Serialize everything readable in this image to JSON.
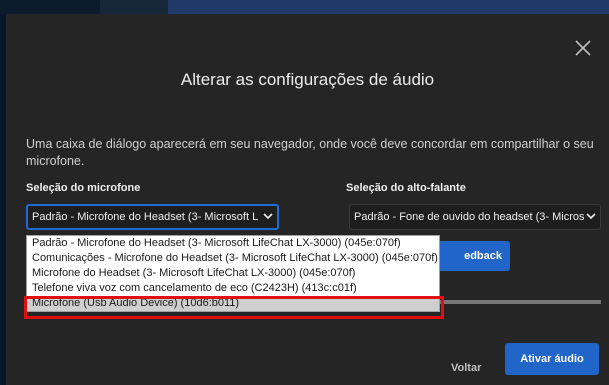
{
  "dialog": {
    "title": "Alterar as configurações de áudio",
    "description": "Uma caixa de diálogo aparecerá em seu navegador, onde você deve concordar em compartilhar o seu microfone.",
    "close_icon": "close-icon"
  },
  "microphone": {
    "label": "Seleção do microfone",
    "selected": "Padrão - Microfone do Headset (3- Microsoft L",
    "options": [
      "Padrão - Microfone do Headset (3- Microsoft LifeChat LX-3000) (045e:070f)",
      "Comunicações - Microfone do Headset (3- Microsoft LifeChat LX-3000) (045e:070f)",
      "Microfone do Headset (3- Microsoft LifeChat LX-3000) (045e:070f)",
      "Telefone viva voz com cancelamento de eco (C2423H) (413c:c01f)",
      "Microfone (Usb Audio Device) (10d6:b011)"
    ],
    "highlighted_index": 4
  },
  "speaker": {
    "label": "Seleção do alto-falante",
    "selected": "Padrão - Fone de ouvido do headset (3- Micros"
  },
  "feedback_button": "edback",
  "footer": {
    "back_label": "Voltar",
    "activate_label": "Ativar áudio"
  },
  "colors": {
    "accent": "#2065c7",
    "highlight_border": "#e01010",
    "modal_bg": "#252525"
  }
}
